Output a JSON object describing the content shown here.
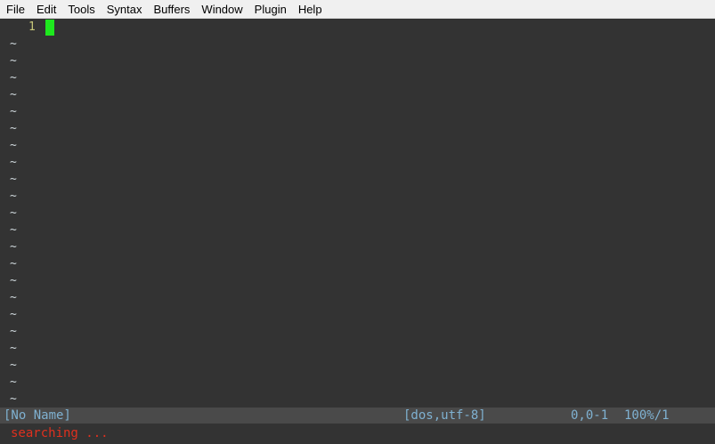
{
  "menu": {
    "items": [
      "File",
      "Edit",
      "Tools",
      "Syntax",
      "Buffers",
      "Window",
      "Plugin",
      "Help"
    ]
  },
  "editor": {
    "line_number": "1",
    "tilde": "~",
    "empty_line_count_note": "tilde rows shown for unused lines"
  },
  "statusline": {
    "buffer_name": "[No Name]",
    "file_format": "[dos,utf-8]",
    "position": "0,0-1",
    "percent": "100%/1"
  },
  "cmdline": {
    "message": "searching ..."
  },
  "colors": {
    "background": "#333333",
    "line_number": "#c7c77a",
    "cursor": "#1ee81e",
    "statusline_text": "#7fb1d1",
    "message": "#e0301e"
  }
}
